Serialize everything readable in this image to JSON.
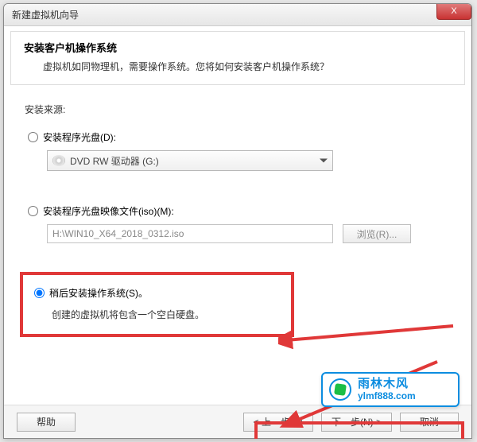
{
  "window": {
    "title": "新建虚拟机向导",
    "close": "X"
  },
  "header": {
    "title": "安装客户机操作系统",
    "subtitle": "虚拟机如同物理机，需要操作系统。您将如何安装客户机操作系统？"
  },
  "source": {
    "label": "安装来源:",
    "disc": {
      "label": "安装程序光盘(D):",
      "dropdown": "DVD RW 驱动器 (G:)"
    },
    "iso": {
      "label": "安装程序光盘映像文件(iso)(M):",
      "path": "H:\\WIN10_X64_2018_0312.iso",
      "browse": "浏览(R)..."
    },
    "later": {
      "label": "稍后安装操作系统(S)。",
      "hint": "创建的虚拟机将包含一个空白硬盘。"
    }
  },
  "footer": {
    "help": "帮助",
    "back": "< 上一步(B)",
    "next": "下一步(N) >",
    "cancel": "取消"
  },
  "watermark": {
    "title": "雨林木风",
    "url": "ylmf888.com"
  }
}
